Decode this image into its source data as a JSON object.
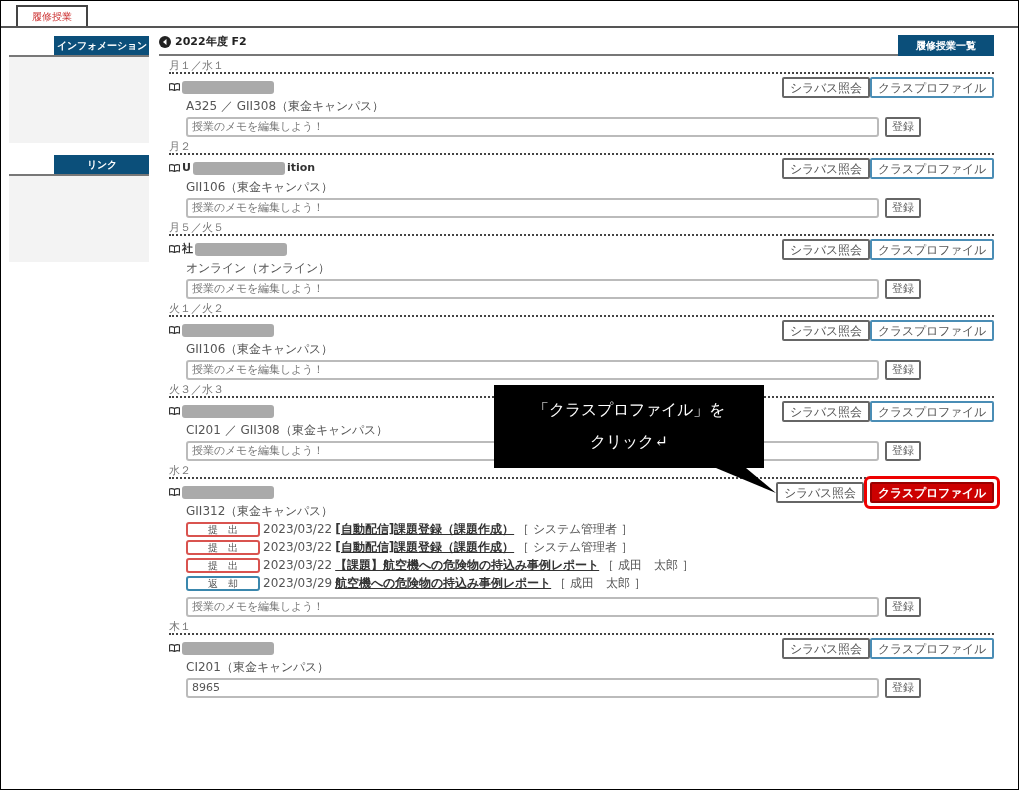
{
  "tabs": [
    {
      "label": "履修授業",
      "selected": true
    }
  ],
  "sidebar": [
    {
      "title": "インフォメーション"
    },
    {
      "title": "リンク"
    }
  ],
  "header": {
    "title": "2022年度 F2",
    "list_button": "履修授業一覧"
  },
  "courses": [
    {
      "period": "月１／水１",
      "room": "A325 ／ GII308（東金キャンパス）",
      "syllabus_button": "シラバス照会",
      "profile_button": "クラスプロファイル",
      "highlighted": false,
      "memo_placeholder": "授業のメモを編集しよう！",
      "register_button": "登録"
    },
    {
      "period": "月２",
      "name_before": "U",
      "name_after": "ition",
      "room": "GII106（東金キャンパス）",
      "syllabus_button": "シラバス照会",
      "profile_button": "クラスプロファイル",
      "highlighted": false,
      "memo_placeholder": "授業のメモを編集しよう！",
      "register_button": "登録"
    },
    {
      "period": "月５／火５",
      "name_before": "社",
      "room": "オンライン（オンライン）",
      "syllabus_button": "シラバス照会",
      "profile_button": "クラスプロファイル",
      "highlighted": false,
      "memo_placeholder": "授業のメモを編集しよう！",
      "register_button": "登録"
    },
    {
      "period": "火１／火２",
      "room": "GII106（東金キャンパス）",
      "syllabus_button": "シラバス照会",
      "profile_button": "クラスプロファイル",
      "highlighted": false,
      "memo_placeholder": "授業のメモを編集しよう！",
      "register_button": "登録"
    },
    {
      "period": "火３／水３",
      "room": "CI201 ／ GII308（東金キャンパス）",
      "syllabus_button": "シラバス照会",
      "profile_button": "クラスプロファイル",
      "highlighted": false,
      "memo_placeholder": "授業のメモを編集しよう！",
      "register_button": "登録"
    },
    {
      "period": "水２",
      "room": "GII312（東金キャンパス）",
      "syllabus_button": "シラバス照会",
      "profile_button": "クラスプロファイル",
      "highlighted": true,
      "memo_placeholder": "授業のメモを編集しよう！",
      "register_button": "登録",
      "notices": [
        {
          "status": "提　出",
          "color": "#d9534f",
          "date": "2023/03/22",
          "title": "[自動配信]課題登録（課題作成）",
          "author": "［ システム管理者 ］"
        },
        {
          "status": "提　出",
          "color": "#d9534f",
          "date": "2023/03/22",
          "title": "[自動配信]課題登録（課題作成）",
          "author": "［ システム管理者 ］"
        },
        {
          "status": "提　出",
          "color": "#d9534f",
          "date": "2023/03/22",
          "title": "【課題】航空機への危険物の持込み事例レポート",
          "author": "［ 成田　太郎 ］"
        },
        {
          "status": "返　却",
          "color": "#3a87ad",
          "date": "2023/03/29",
          "title": "航空機への危険物の持込み事例レポート",
          "author": "［ 成田　太郎 ］"
        }
      ]
    },
    {
      "period": "木１",
      "room": "CI201（東金キャンパス）",
      "syllabus_button": "シラバス照会",
      "profile_button": "クラスプロファイル",
      "highlighted": false,
      "memo_value": "8965",
      "register_button": "登録"
    }
  ],
  "callout": {
    "lines": [
      "「クラスプロファイル」を",
      "クリック↵"
    ]
  }
}
